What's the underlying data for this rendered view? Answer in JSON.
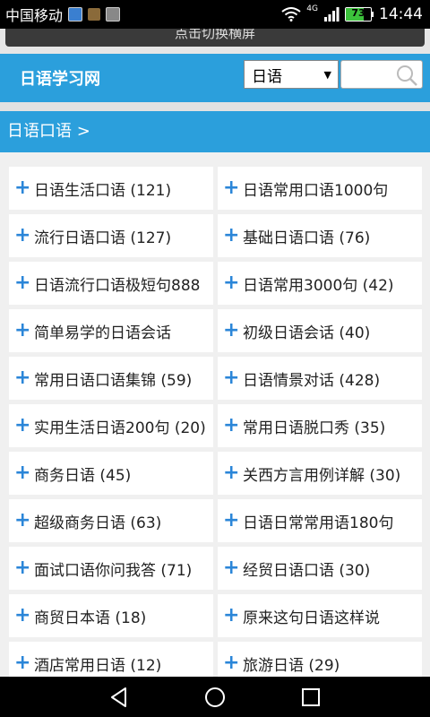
{
  "status_bar": {
    "carrier": "中国移动",
    "network_type": "4G",
    "battery": "73",
    "battery_level": 0.73,
    "time": "14:44"
  },
  "rotate_banner": {
    "label": "点击切换横屏"
  },
  "header": {
    "site_title": "日语学习网",
    "language_select": "日语",
    "search_placeholder": ""
  },
  "section": {
    "title": "日语口语 >"
  },
  "items": [
    [
      "日语生活口语 (121)",
      "日语常用口语1000句"
    ],
    [
      "流行日语口语 (127)",
      "基础日语口语 (76)"
    ],
    [
      "日语流行口语极短句888",
      "日语常用3000句 (42)"
    ],
    [
      "简单易学的日语会话",
      "初级日语会话 (40)"
    ],
    [
      "常用日语口语集锦 (59)",
      "日语情景对话 (428)"
    ],
    [
      "实用生活日语200句 (20)",
      "常用日语脱口秀 (35)"
    ],
    [
      "商务日语 (45)",
      "关西方言用例详解 (30)"
    ],
    [
      "超级商务日语 (63)",
      "日语日常常用语180句"
    ],
    [
      "面试口语你问我答 (71)",
      "经贸日语口语 (30)"
    ],
    [
      "商贸日本语 (18)",
      "原来这句日语这样说"
    ],
    [
      "酒店常用日语 (12)",
      "旅游日语 (29)"
    ]
  ],
  "colors": {
    "accent": "#2b9fdc",
    "plus": "#2b86d8",
    "battery": "#3cc23c"
  }
}
